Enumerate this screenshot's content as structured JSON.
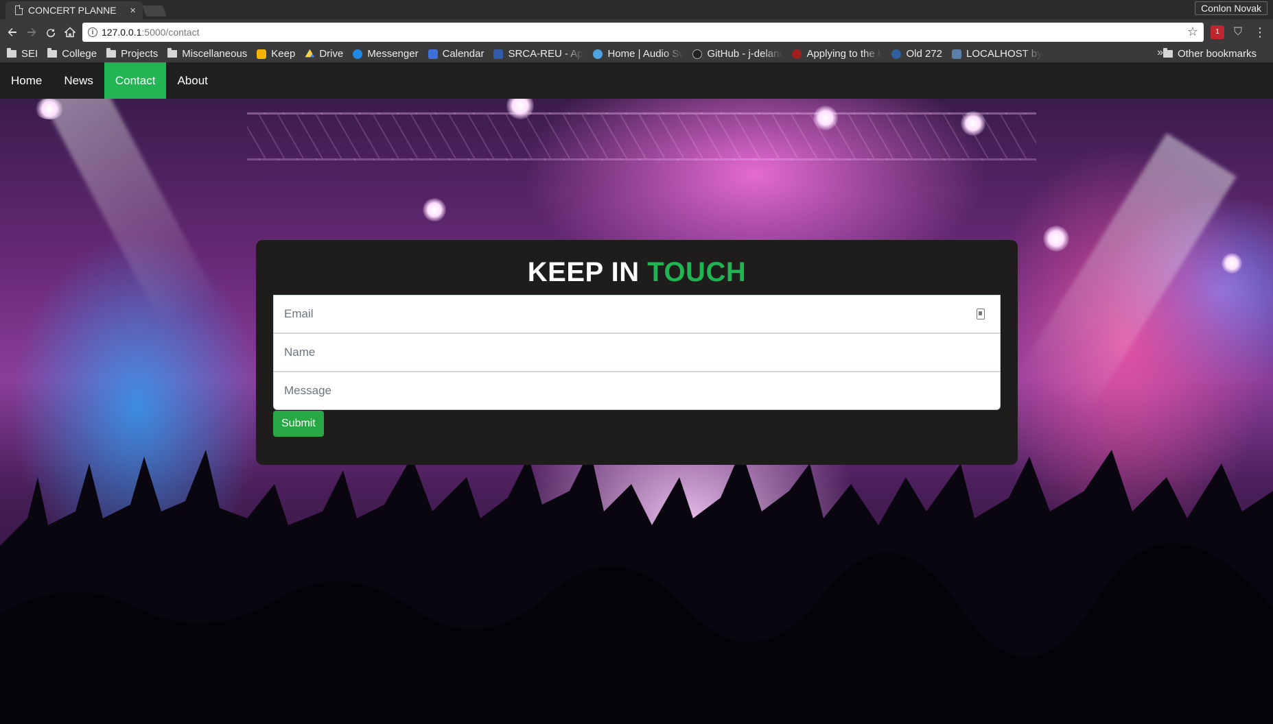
{
  "browser": {
    "tab_title": "CONCERT PLANNE",
    "tab_close": "×",
    "profile_name": "Conlon Novak",
    "url_host": "127.0.0.1",
    "url_path": ":5000/contact",
    "extension_badge": "1",
    "bookmarks": [
      {
        "label": "SEI",
        "icon": "folder-icon"
      },
      {
        "label": "College",
        "icon": "folder-icon"
      },
      {
        "label": "Projects",
        "icon": "folder-icon"
      },
      {
        "label": "Miscellaneous",
        "icon": "folder-icon"
      },
      {
        "label": "Keep",
        "icon": "keep-icon",
        "color": "#f6b400"
      },
      {
        "label": "Drive",
        "icon": "drive-icon",
        "color": "#1fa463"
      },
      {
        "label": "Messenger",
        "icon": "messenger-icon",
        "color": "#1e88e5"
      },
      {
        "label": "Calendar",
        "icon": "calendar-icon",
        "color": "#3d6fd8"
      },
      {
        "label": "SRCA-REU - Appl",
        "icon": "srca-icon",
        "color": "#2f5ba8"
      },
      {
        "label": "Home | Audio Sw",
        "icon": "audio-icon",
        "color": "#4fa3e0"
      },
      {
        "label": "GitHub - j-delane",
        "icon": "github-icon",
        "color": "#222222"
      },
      {
        "label": "Applying to the U",
        "icon": "university-icon",
        "color": "#a31f1f"
      },
      {
        "label": "Old 272",
        "icon": "old272-icon",
        "color": "#3060a0"
      },
      {
        "label": "LOCALHOST by A",
        "icon": "localhost-icon",
        "color": "#5a7fa8"
      }
    ],
    "bookmarks_overflow": "»",
    "other_bookmarks": "Other bookmarks"
  },
  "site_nav": {
    "items": [
      {
        "label": "Home",
        "active": false
      },
      {
        "label": "News",
        "active": false
      },
      {
        "label": "Contact",
        "active": true
      },
      {
        "label": "About",
        "active": false
      }
    ]
  },
  "contact_form": {
    "title_part1": "KEEP IN",
    "title_part2": "TOUCH",
    "email_placeholder": "Email",
    "name_placeholder": "Name",
    "message_placeholder": "Message",
    "submit_label": "Submit"
  },
  "colors": {
    "accent": "#21b653",
    "nav_bg": "#1f1f1f",
    "card_bg": "#1f1c1c",
    "submit_bg": "#28a745"
  }
}
